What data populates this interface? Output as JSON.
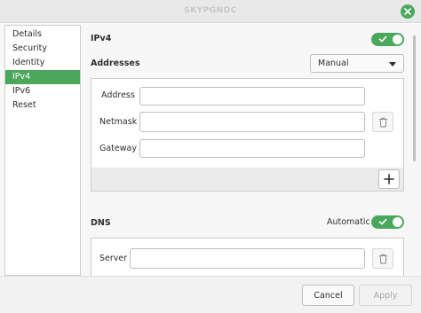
{
  "window": {
    "title": "SKYPGNDC"
  },
  "sidebar": {
    "items": [
      {
        "label": "Details"
      },
      {
        "label": "Security"
      },
      {
        "label": "Identity"
      },
      {
        "label": "IPv4"
      },
      {
        "label": "IPv6"
      },
      {
        "label": "Reset"
      }
    ],
    "selected": "IPv4"
  },
  "ipv4": {
    "label": "IPv4",
    "enabled": true
  },
  "addresses": {
    "label": "Addresses",
    "method_value": "Manual",
    "fields": {
      "address_label": "Address",
      "address_value": "",
      "netmask_label": "Netmask",
      "netmask_value": "",
      "gateway_label": "Gateway",
      "gateway_value": ""
    }
  },
  "dns": {
    "label": "DNS",
    "automatic_label": "Automatic",
    "automatic_enabled": true,
    "server_label": "Server",
    "server_value": ""
  },
  "footer": {
    "cancel_label": "Cancel",
    "apply_label": "Apply"
  },
  "colors": {
    "accent": "#4aa85d",
    "sidebar_active_bg": "#4aa85d",
    "disabled_text": "#a8a8a8"
  },
  "icons": {
    "close": "close-icon",
    "trash": "trash-icon",
    "add": "plus-icon",
    "dropdown": "chevron-down-icon",
    "toggle_check": "check-icon"
  }
}
